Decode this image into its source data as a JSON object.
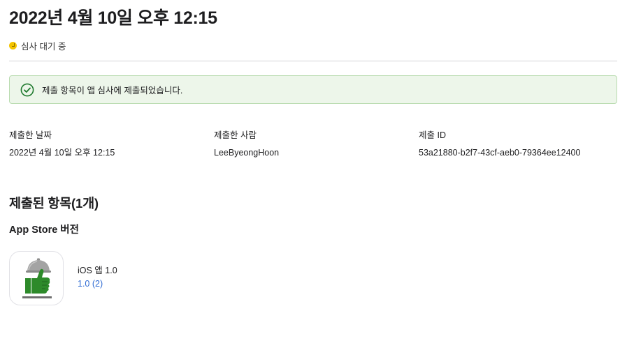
{
  "header": {
    "title": "2022년 4월 10일 오후 12:15",
    "status": "심사 대기 중",
    "status_color": "#f4c400"
  },
  "banner": {
    "message": "제출 항목이 앱 심사에 제출되었습니다.",
    "icon": "check-circle-icon",
    "background": "#edf6ea",
    "accent": "#1f7a2e"
  },
  "meta": {
    "date_label": "제출한 날짜",
    "date_value": "2022년 4월 10일 오후 12:15",
    "submitter_label": "제출한 사람",
    "submitter_value": "LeeByeongHoon",
    "id_label": "제출 ID",
    "id_value": "53a21880-b2f7-43cf-aeb0-79364ee12400"
  },
  "items": {
    "section_title": "제출된 항목(1개)",
    "group_title": "App Store 버전",
    "app": {
      "icon": "thumbs-up-cloche-icon",
      "name": "iOS 앱 1.0",
      "version": "1.0 (2)",
      "link_color": "#2f6bd3"
    }
  }
}
